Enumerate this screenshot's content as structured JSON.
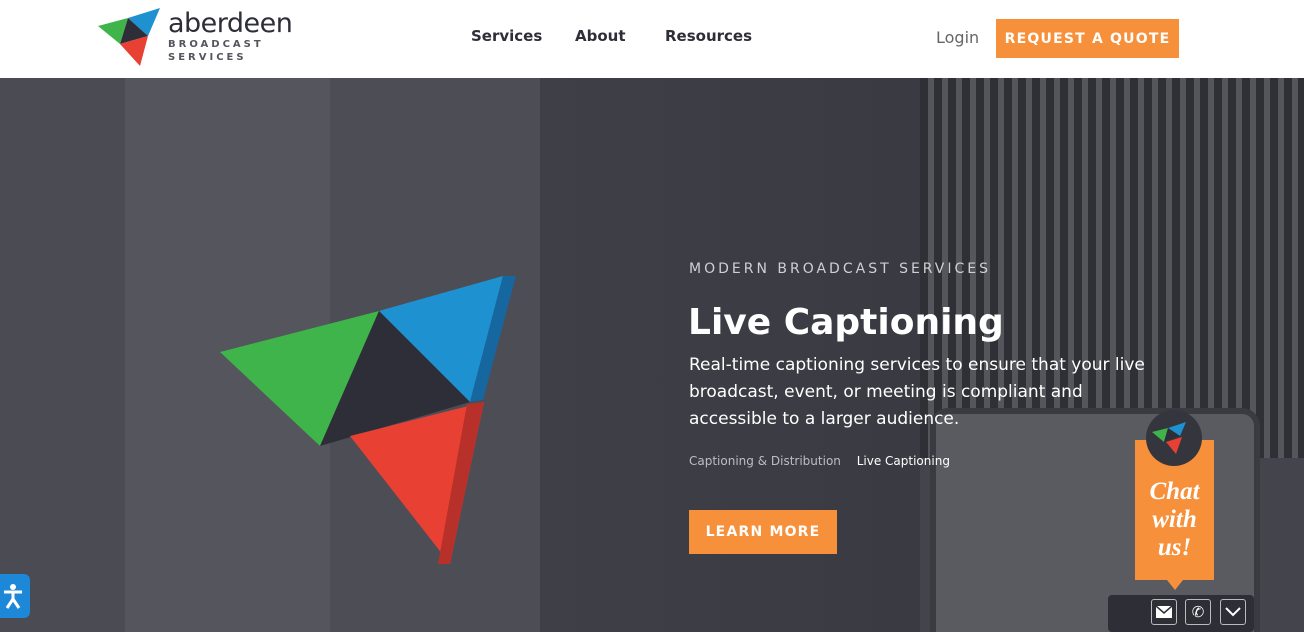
{
  "brand": {
    "name": "aberdeen",
    "sub1": "BROADCAST",
    "sub2": "SERVICES",
    "colors": {
      "green": "#3fb44a",
      "blue": "#1e91d0",
      "red": "#e84033",
      "dark": "#2e2e38",
      "accent": "#f7903a"
    }
  },
  "nav": {
    "items": [
      {
        "label": "Services"
      },
      {
        "label": "About"
      },
      {
        "label": "Resources"
      }
    ],
    "login": "Login",
    "quote": "REQUEST A QUOTE"
  },
  "hero": {
    "eyebrow": "MODERN BROADCAST SERVICES",
    "title": "Live Captioning",
    "description": "Real-time captioning services to ensure that your live broadcast, event, or meeting is compliant and accessible to a larger audience.",
    "breadcrumbs": [
      "Captioning & Distribution",
      "Live Captioning"
    ],
    "cta": "LEARN MORE"
  },
  "chat": {
    "line1": "Chat",
    "line2": "with",
    "line3": "us!",
    "icons": [
      "mail-icon",
      "phone-icon",
      "chevron-down-icon"
    ]
  }
}
